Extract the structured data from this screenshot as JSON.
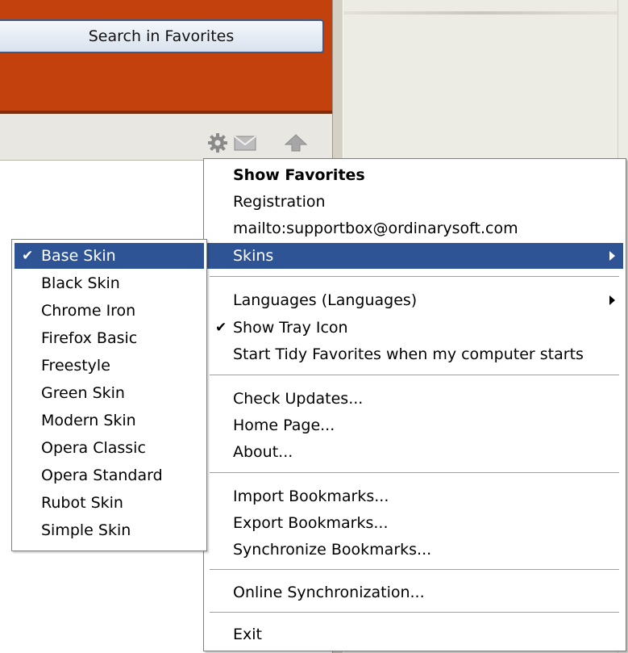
{
  "search_button": "Search in Favorites",
  "toolbar_icons": [
    "gear-icon",
    "mail-icon",
    "up-arrow-icon"
  ],
  "menu": {
    "show_favorites": "Show Favorites",
    "registration": "Registration",
    "mailto": "mailto:supportbox@ordinarysoft.com",
    "skins": "Skins",
    "languages": "Languages (Languages)",
    "show_tray_icon": "Show Tray Icon",
    "start_on_boot": "Start Tidy Favorites when my computer starts",
    "check_updates": "Check Updates...",
    "home_page": "Home Page...",
    "about": "About...",
    "import_bookmarks": "Import Bookmarks...",
    "export_bookmarks": "Export Bookmarks...",
    "sync_bookmarks": "Synchronize Bookmarks...",
    "online_sync": "Online Synchronization...",
    "exit": "Exit",
    "checkmark": "✔"
  },
  "skins": {
    "items": [
      "Base Skin",
      "Black Skin",
      "Chrome Iron",
      "Firefox Basic",
      "Freestyle",
      "Green Skin",
      "Modern Skin",
      "Opera Classic",
      "Opera Standard",
      "Rubot Skin",
      "Simple Skin"
    ],
    "selected": "Base Skin"
  },
  "colors": {
    "header_orange": "#c2410c",
    "highlight": "#2f5496"
  }
}
